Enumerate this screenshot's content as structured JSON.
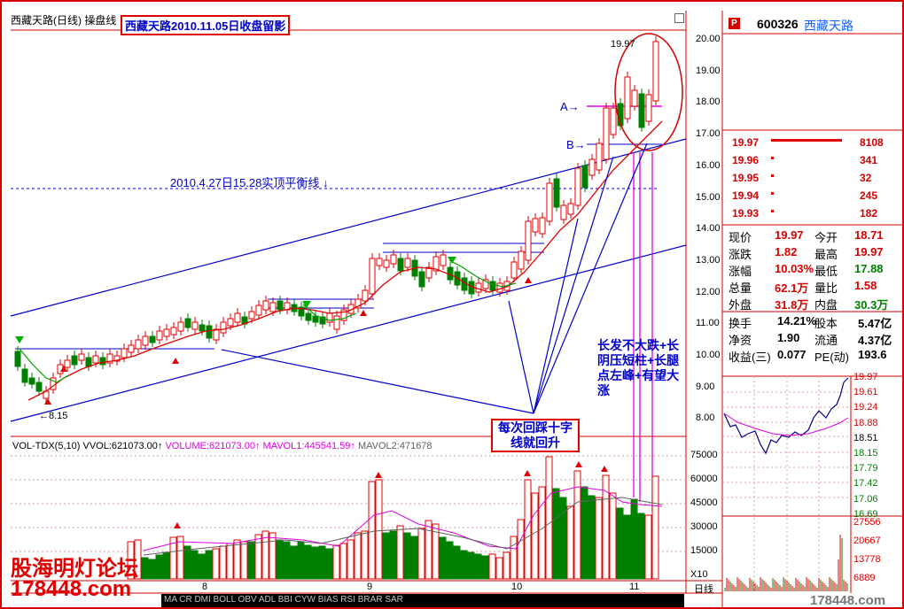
{
  "window": {
    "title": "西藏天路(日线) 操盘线"
  },
  "sign": "西藏天路2010.11.05日收盘留影",
  "annotations": {
    "high_label": "19.97",
    "low_label": "←8.15",
    "a_label": "A→",
    "b_label": "B→",
    "balance_line": "2010.4.27日15.28实顶平衡线 ↓",
    "note_right": "长发不大跌+长阴压短柱+长腿点左峰+有望大涨",
    "note_bottom": "每次回踩十字线就回升"
  },
  "price_axis": [
    "20.00",
    "19.00",
    "18.00",
    "17.00",
    "16.00",
    "15.00",
    "14.00",
    "13.00",
    "12.00",
    "11.00",
    "10.00",
    "9.00",
    "8.00"
  ],
  "volume_axis": [
    "75000",
    "60000",
    "45000",
    "30000",
    "15000",
    "X10"
  ],
  "volume_legend": {
    "a": "VOL-TDX(5,10)",
    "b": "VVOL:621073.00↑",
    "c": "VOLUME:621073.00↑",
    "d": "MAVOL1:445541.59↑",
    "e": "MAVOL2:471678"
  },
  "date_axis": [
    "8",
    "9",
    "10",
    "11"
  ],
  "bottom_tabs": "MA  CR  DMI  BOLL  OBV  ADL  BBI  CYW  BIAS  RSI  BRAR  SAR",
  "period_tab": "日线",
  "watermark": {
    "line1": "股海明灯论坛",
    "line2": "178448.com",
    "corner": "178448.com"
  },
  "quote": {
    "code": "600326",
    "name": "西藏天路",
    "badge": "P",
    "order_book": [
      {
        "price": "19.97",
        "vol": "8108"
      },
      {
        "price": "19.96",
        "vol": "341"
      },
      {
        "price": "19.95",
        "vol": "32"
      },
      {
        "price": "19.94",
        "vol": "245"
      },
      {
        "price": "19.93",
        "vol": "182"
      }
    ],
    "stats": [
      {
        "l1": "现价",
        "v1": "19.97",
        "l2": "今开",
        "v2": "18.71"
      },
      {
        "l1": "涨跌",
        "v1": "1.82",
        "l2": "最高",
        "v2": "19.97"
      },
      {
        "l1": "涨幅",
        "v1": "10.03%",
        "l2": "最低",
        "v2": "17.88"
      },
      {
        "l1": "总量",
        "v1": "62.1万",
        "l2": "量比",
        "v2": "1.58"
      },
      {
        "l1": "外盘",
        "v1": "31.8万",
        "l2": "内盘",
        "v2": "30.3万"
      }
    ],
    "stats2": [
      {
        "l1": "换手",
        "v1": "14.21%",
        "l2": "股本",
        "v2": "5.47亿"
      },
      {
        "l1": "净资",
        "v1": "1.90",
        "l2": "流通",
        "v2": "4.37亿"
      },
      {
        "l1": "收益(三)",
        "v1": "0.077",
        "l2": "PE(动)",
        "v2": "193.6"
      }
    ],
    "intraday_axis": [
      "19.97",
      "19.61",
      "19.24",
      "18.88",
      "18.51",
      "18.15",
      "17.79",
      "17.42",
      "17.06",
      "16.69"
    ],
    "intraday_vol_axis": [
      "27556",
      "20667",
      "13778",
      "6889"
    ]
  },
  "colors": {
    "up": "#e00000",
    "down": "#008000",
    "channel": "#0000c8",
    "ma": "#e00000",
    "accent": "#e000e0"
  }
}
